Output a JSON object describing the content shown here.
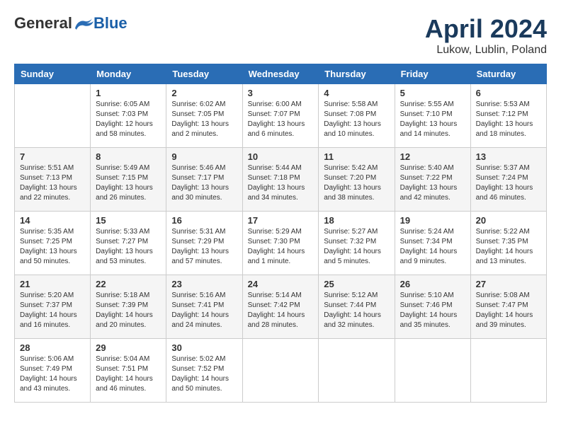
{
  "header": {
    "logo_general": "General",
    "logo_blue": "Blue",
    "month_title": "April 2024",
    "location": "Lukow, Lublin, Poland"
  },
  "days_of_week": [
    "Sunday",
    "Monday",
    "Tuesday",
    "Wednesday",
    "Thursday",
    "Friday",
    "Saturday"
  ],
  "weeks": [
    [
      {
        "day": "",
        "info": ""
      },
      {
        "day": "1",
        "info": "Sunrise: 6:05 AM\nSunset: 7:03 PM\nDaylight: 12 hours\nand 58 minutes."
      },
      {
        "day": "2",
        "info": "Sunrise: 6:02 AM\nSunset: 7:05 PM\nDaylight: 13 hours\nand 2 minutes."
      },
      {
        "day": "3",
        "info": "Sunrise: 6:00 AM\nSunset: 7:07 PM\nDaylight: 13 hours\nand 6 minutes."
      },
      {
        "day": "4",
        "info": "Sunrise: 5:58 AM\nSunset: 7:08 PM\nDaylight: 13 hours\nand 10 minutes."
      },
      {
        "day": "5",
        "info": "Sunrise: 5:55 AM\nSunset: 7:10 PM\nDaylight: 13 hours\nand 14 minutes."
      },
      {
        "day": "6",
        "info": "Sunrise: 5:53 AM\nSunset: 7:12 PM\nDaylight: 13 hours\nand 18 minutes."
      }
    ],
    [
      {
        "day": "7",
        "info": "Sunrise: 5:51 AM\nSunset: 7:13 PM\nDaylight: 13 hours\nand 22 minutes."
      },
      {
        "day": "8",
        "info": "Sunrise: 5:49 AM\nSunset: 7:15 PM\nDaylight: 13 hours\nand 26 minutes."
      },
      {
        "day": "9",
        "info": "Sunrise: 5:46 AM\nSunset: 7:17 PM\nDaylight: 13 hours\nand 30 minutes."
      },
      {
        "day": "10",
        "info": "Sunrise: 5:44 AM\nSunset: 7:18 PM\nDaylight: 13 hours\nand 34 minutes."
      },
      {
        "day": "11",
        "info": "Sunrise: 5:42 AM\nSunset: 7:20 PM\nDaylight: 13 hours\nand 38 minutes."
      },
      {
        "day": "12",
        "info": "Sunrise: 5:40 AM\nSunset: 7:22 PM\nDaylight: 13 hours\nand 42 minutes."
      },
      {
        "day": "13",
        "info": "Sunrise: 5:37 AM\nSunset: 7:24 PM\nDaylight: 13 hours\nand 46 minutes."
      }
    ],
    [
      {
        "day": "14",
        "info": "Sunrise: 5:35 AM\nSunset: 7:25 PM\nDaylight: 13 hours\nand 50 minutes."
      },
      {
        "day": "15",
        "info": "Sunrise: 5:33 AM\nSunset: 7:27 PM\nDaylight: 13 hours\nand 53 minutes."
      },
      {
        "day": "16",
        "info": "Sunrise: 5:31 AM\nSunset: 7:29 PM\nDaylight: 13 hours\nand 57 minutes."
      },
      {
        "day": "17",
        "info": "Sunrise: 5:29 AM\nSunset: 7:30 PM\nDaylight: 14 hours\nand 1 minute."
      },
      {
        "day": "18",
        "info": "Sunrise: 5:27 AM\nSunset: 7:32 PM\nDaylight: 14 hours\nand 5 minutes."
      },
      {
        "day": "19",
        "info": "Sunrise: 5:24 AM\nSunset: 7:34 PM\nDaylight: 14 hours\nand 9 minutes."
      },
      {
        "day": "20",
        "info": "Sunrise: 5:22 AM\nSunset: 7:35 PM\nDaylight: 14 hours\nand 13 minutes."
      }
    ],
    [
      {
        "day": "21",
        "info": "Sunrise: 5:20 AM\nSunset: 7:37 PM\nDaylight: 14 hours\nand 16 minutes."
      },
      {
        "day": "22",
        "info": "Sunrise: 5:18 AM\nSunset: 7:39 PM\nDaylight: 14 hours\nand 20 minutes."
      },
      {
        "day": "23",
        "info": "Sunrise: 5:16 AM\nSunset: 7:41 PM\nDaylight: 14 hours\nand 24 minutes."
      },
      {
        "day": "24",
        "info": "Sunrise: 5:14 AM\nSunset: 7:42 PM\nDaylight: 14 hours\nand 28 minutes."
      },
      {
        "day": "25",
        "info": "Sunrise: 5:12 AM\nSunset: 7:44 PM\nDaylight: 14 hours\nand 32 minutes."
      },
      {
        "day": "26",
        "info": "Sunrise: 5:10 AM\nSunset: 7:46 PM\nDaylight: 14 hours\nand 35 minutes."
      },
      {
        "day": "27",
        "info": "Sunrise: 5:08 AM\nSunset: 7:47 PM\nDaylight: 14 hours\nand 39 minutes."
      }
    ],
    [
      {
        "day": "28",
        "info": "Sunrise: 5:06 AM\nSunset: 7:49 PM\nDaylight: 14 hours\nand 43 minutes."
      },
      {
        "day": "29",
        "info": "Sunrise: 5:04 AM\nSunset: 7:51 PM\nDaylight: 14 hours\nand 46 minutes."
      },
      {
        "day": "30",
        "info": "Sunrise: 5:02 AM\nSunset: 7:52 PM\nDaylight: 14 hours\nand 50 minutes."
      },
      {
        "day": "",
        "info": ""
      },
      {
        "day": "",
        "info": ""
      },
      {
        "day": "",
        "info": ""
      },
      {
        "day": "",
        "info": ""
      }
    ]
  ]
}
